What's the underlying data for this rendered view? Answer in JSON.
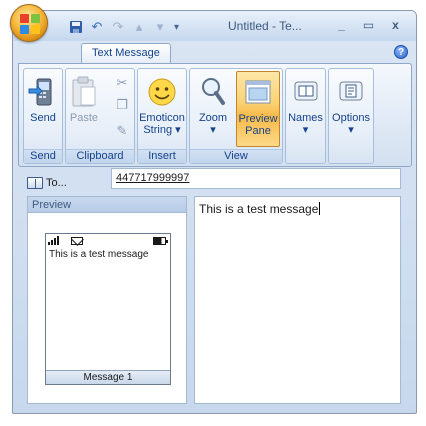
{
  "window": {
    "title": "Untitled - Te...",
    "controls": {
      "minimize": "_",
      "maximize": "▭",
      "close": "x"
    }
  },
  "quick_access": {
    "icons": [
      "save-icon",
      "undo-icon",
      "redo-icon",
      "up-arrow-icon",
      "down-arrow-icon",
      "customize-dropdown-icon"
    ]
  },
  "tabs": [
    {
      "label": "Text Message",
      "active": true
    }
  ],
  "help_icon": "?",
  "ribbon": {
    "groups": [
      {
        "label": "Send",
        "buttons": [
          {
            "label": "Send",
            "icon": "phone-send-icon"
          }
        ]
      },
      {
        "label": "Clipboard",
        "buttons": [
          {
            "label": "Paste",
            "icon": "paste-icon",
            "disabled": true
          }
        ],
        "small_icons": [
          "cut-icon",
          "copy-icon",
          "format-painter-icon"
        ]
      },
      {
        "label": "Insert",
        "buttons": [
          {
            "label_line1": "Emoticon",
            "label_line2": "String",
            "icon": "smiley-icon"
          }
        ]
      },
      {
        "label": "View",
        "buttons": [
          {
            "label": "Zoom",
            "icon": "magnifier-icon"
          },
          {
            "label_line1": "Preview",
            "label_line2": "Pane",
            "icon": "preview-pane-icon",
            "active": true
          }
        ]
      },
      {
        "label": "",
        "buttons": [
          {
            "label": "Names",
            "icon": "address-book-icon"
          }
        ]
      },
      {
        "label": "",
        "buttons": [
          {
            "label": "Options",
            "icon": "options-icon"
          }
        ]
      }
    ]
  },
  "recipient": {
    "button_label": "To...",
    "value": "447717999997"
  },
  "preview": {
    "header": "Preview",
    "message": "This is a test message",
    "footer": "Message 1"
  },
  "message_body": "This is a test message",
  "colors": {
    "ribbon_blue": "#c7d8ed",
    "text_blue": "#15428b",
    "active_orange": "#f8b949",
    "office_orb": "#f6b93b"
  }
}
